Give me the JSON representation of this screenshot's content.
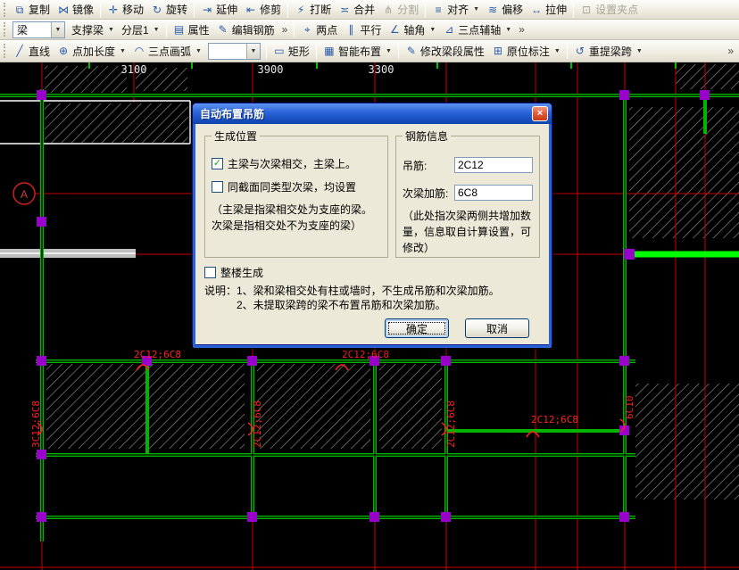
{
  "icons": {
    "dropdown": "▼",
    "overflow": "»",
    "close": "×",
    "check": "✓"
  },
  "colors": {
    "beam_green": "#00b400",
    "beam_highlight": "#00ff00",
    "node_purple": "#9900cc",
    "grid_red": "#c80000",
    "label_red": "#ff2020",
    "titlebar_blue": "#2a63d8",
    "toolbar_bg": "#efece0"
  },
  "toolbar_edit": {
    "copy": {
      "icon": "⧉",
      "label": "复制"
    },
    "mirror": {
      "icon": "⋈",
      "label": "镜像"
    },
    "move": {
      "icon": "✛",
      "label": "移动"
    },
    "rotate": {
      "icon": "↻",
      "label": "旋转"
    },
    "extend": {
      "icon": "⇥",
      "label": "延伸"
    },
    "trim": {
      "icon": "⇤",
      "label": "修剪"
    },
    "break": {
      "icon": "⚡",
      "label": "打断"
    },
    "merge": {
      "icon": "≍",
      "label": "合并"
    },
    "split": {
      "icon": "⋔",
      "label": "分割"
    },
    "align": {
      "icon": "≡",
      "label": "对齐"
    },
    "offset": {
      "icon": "≋",
      "label": "偏移"
    },
    "stretch": {
      "icon": "↔",
      "label": "拉伸"
    },
    "set_grips": {
      "icon": "⊡",
      "label": "设置夹点"
    }
  },
  "toolbar_layer": {
    "combo_value": "梁",
    "support_beam": {
      "label": "支撑梁"
    },
    "layer": {
      "label": "分层1"
    },
    "props": {
      "icon": "▤",
      "label": "属性"
    },
    "edit_rebar": {
      "icon": "✎",
      "label": "编辑钢筋"
    },
    "two_point": {
      "icon": "⌖",
      "label": "两点"
    },
    "parallel": {
      "icon": "∥",
      "label": "平行"
    },
    "axis_angle": {
      "icon": "∠",
      "label": "轴角"
    },
    "three_point_aux": {
      "icon": "⊿",
      "label": "三点辅轴"
    }
  },
  "toolbar_draw": {
    "line": {
      "icon": "╱",
      "label": "直线"
    },
    "point_length": {
      "icon": "⊕",
      "label": "点加长度"
    },
    "arc3": {
      "icon": "◠",
      "label": "三点画弧"
    },
    "combo_value": "",
    "rect": {
      "icon": "▭",
      "label": "矩形"
    },
    "smart": {
      "icon": "▦",
      "label": "智能布置"
    },
    "modify": {
      "icon": "✎",
      "label": "修改梁段属性"
    },
    "insitu": {
      "icon": "⊞",
      "label": "原位标注"
    },
    "respan": {
      "icon": "↺",
      "label": "重提梁跨"
    }
  },
  "dialog": {
    "title": "自动布置吊筋",
    "group_position": {
      "title": "生成位置",
      "cb_main": "主梁与次梁相交，主梁上。",
      "cb_same_section": "同截面同类型次梁，均设置",
      "note": "（主梁是指梁相交处为支座的梁。\n次梁是指相交处不为支座的梁）"
    },
    "group_rebar": {
      "title": "钢筋信息",
      "hanging_label": "吊筋:",
      "hanging_value": "2C12",
      "secondary_label": "次梁加筋:",
      "secondary_value": "6C8",
      "note": "（此处指次梁两侧共增加数量，信息取自计算设置，可修改）"
    },
    "cb_whole_building": "整楼生成",
    "instructions_line1": "说明：1、梁和梁相交处有柱或墙时，不生成吊筋和次梁加筋。",
    "instructions_line2": "2、未提取梁跨的梁不布置吊筋和次梁加筋。",
    "ok": "确定",
    "cancel": "取消"
  },
  "canvas": {
    "dim_labels": [
      "3100",
      "3900",
      "3300"
    ],
    "axis_label": "A",
    "beam_label": "2C12;6C8",
    "beam_label_left": "3C12;6C8",
    "beam_label_right": "6C10"
  }
}
